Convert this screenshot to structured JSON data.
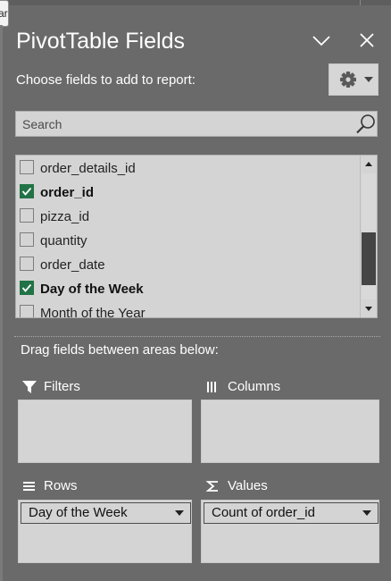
{
  "corner_tab": {
    "text": "ar"
  },
  "panel": {
    "title": "PivotTable Fields",
    "title_menu_icon": "chevron-down-icon",
    "close_icon": "close-icon"
  },
  "toolbar": {
    "choose_label": "Choose fields to add to report:",
    "settings_icon": "gear-icon",
    "settings_dropdown_icon": "caret-down-icon"
  },
  "search": {
    "placeholder": "Search",
    "value": "",
    "icon": "search-icon"
  },
  "fields": [
    {
      "label": "order_details_id",
      "checked": false
    },
    {
      "label": "order_id",
      "checked": true
    },
    {
      "label": "pizza_id",
      "checked": false
    },
    {
      "label": "quantity",
      "checked": false
    },
    {
      "label": "order_date",
      "checked": false
    },
    {
      "label": "Day of the Week",
      "checked": true
    },
    {
      "label": "Month of the Year",
      "checked": false
    }
  ],
  "field_scroll": {
    "position_fraction": 0.8,
    "visible_fraction": 0.42
  },
  "areas": {
    "drag_label": "Drag fields between areas below:",
    "filters": {
      "label": "Filters",
      "icon": "filter-icon",
      "items": []
    },
    "columns": {
      "label": "Columns",
      "icon": "columns-icon",
      "items": []
    },
    "rows": {
      "label": "Rows",
      "icon": "rows-icon",
      "items": [
        "Day of the Week"
      ]
    },
    "values": {
      "label": "Values",
      "icon": "sigma-icon",
      "items": [
        "Count of order_id"
      ]
    }
  },
  "colors": {
    "panel_bg": "#6a6a6a",
    "input_bg": "#d4d4d4",
    "checkbox_checked": "#217346",
    "scroll_thumb": "#454545",
    "text_light": "#ffffff",
    "text_dark": "#222222"
  }
}
